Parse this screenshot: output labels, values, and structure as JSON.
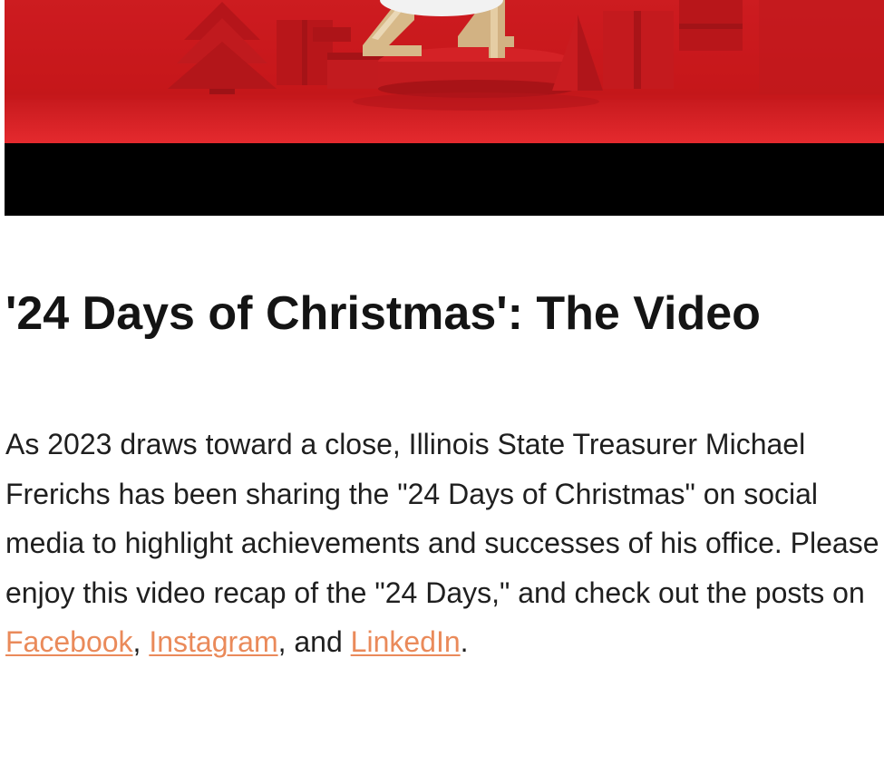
{
  "hero": {
    "image": "24-days-of-christmas-banner",
    "colors": {
      "background": "#c8181c",
      "bar": "#000000",
      "gold": "#d7b989"
    }
  },
  "article": {
    "title": "'24 Days of Christmas': The Video",
    "intro": "As 2023 draws toward a close, Illinois State Treasurer Michael Frerichs has been sharing the \"24 Days of Christmas\" on social media to highlight achievements and successes of his office. Please enjoy this video recap of the \"24 Days,\" and check out the posts on ",
    "links": {
      "facebook": "Facebook",
      "instagram": "Instagram",
      "linkedin": "LinkedIn"
    },
    "sep_1": ", ",
    "sep_2": ", and ",
    "end": "."
  },
  "colors": {
    "link": "#ea8a5a",
    "text": "#1f1f1f"
  }
}
